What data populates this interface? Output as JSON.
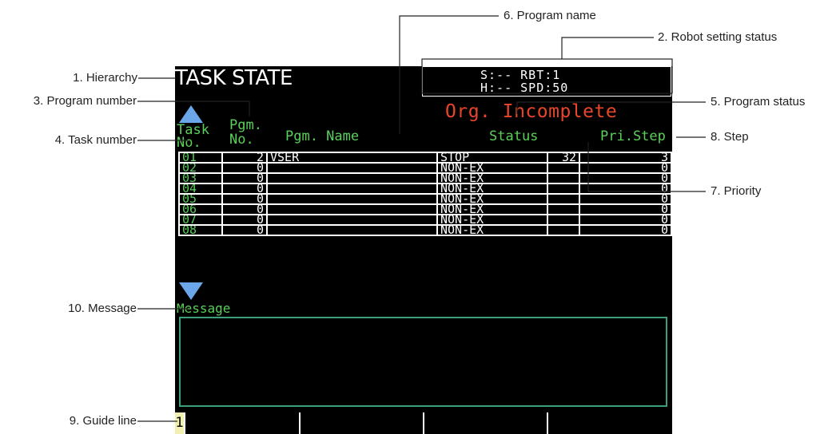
{
  "screen": {
    "title": "TASK STATE",
    "robot_status": {
      "line1": "S:-- RBT:1",
      "line2": "H:-- SPD:50"
    },
    "program_status": "Org. Incomplete",
    "headers": {
      "task_no_1": "Task",
      "task_no_2": "No.",
      "pgm_no_1": "Pgm.",
      "pgm_no_2": "No.",
      "pgm_name": "Pgm. Name",
      "status": "Status",
      "pri_step": "Pri.Step"
    },
    "rows": [
      {
        "task": "01",
        "pgm": "2",
        "name": "VSER",
        "status": "STOP",
        "pri": "32",
        "step": "3"
      },
      {
        "task": "02",
        "pgm": "0",
        "name": "",
        "status": "NON-EX",
        "pri": "",
        "step": "0"
      },
      {
        "task": "03",
        "pgm": "0",
        "name": "",
        "status": "NON-EX",
        "pri": "",
        "step": "0"
      },
      {
        "task": "04",
        "pgm": "0",
        "name": "",
        "status": "NON-EX",
        "pri": "",
        "step": "0"
      },
      {
        "task": "05",
        "pgm": "0",
        "name": "",
        "status": "NON-EX",
        "pri": "",
        "step": "0"
      },
      {
        "task": "06",
        "pgm": "0",
        "name": "",
        "status": "NON-EX",
        "pri": "",
        "step": "0"
      },
      {
        "task": "07",
        "pgm": "0",
        "name": "",
        "status": "NON-EX",
        "pri": "",
        "step": "0"
      },
      {
        "task": "08",
        "pgm": "0",
        "name": "",
        "status": "NON-EX",
        "pri": "",
        "step": "0"
      }
    ],
    "message_label": "Message",
    "guide_cursor": "1"
  },
  "callouts": {
    "hierarchy": "1. Hierarchy",
    "robot_setting_status": "2. Robot setting status",
    "program_number": "3. Program number",
    "task_number": "4. Task number",
    "program_status": "5. Program status",
    "program_name": "6. Program name",
    "priority": "7. Priority",
    "step": "8. Step",
    "guide_line": "9. Guide line",
    "message": "10. Message"
  },
  "colors": {
    "screen_bg": "#000000",
    "header_green": "#5ad05a",
    "status_red": "#e8462a",
    "arrow_blue": "#6aa6e8",
    "message_border": "#3aa07a",
    "cursor_yellow": "#f0f0b0"
  },
  "icons": {
    "scroll_up": "triangle-up-icon",
    "scroll_down": "triangle-down-icon"
  }
}
